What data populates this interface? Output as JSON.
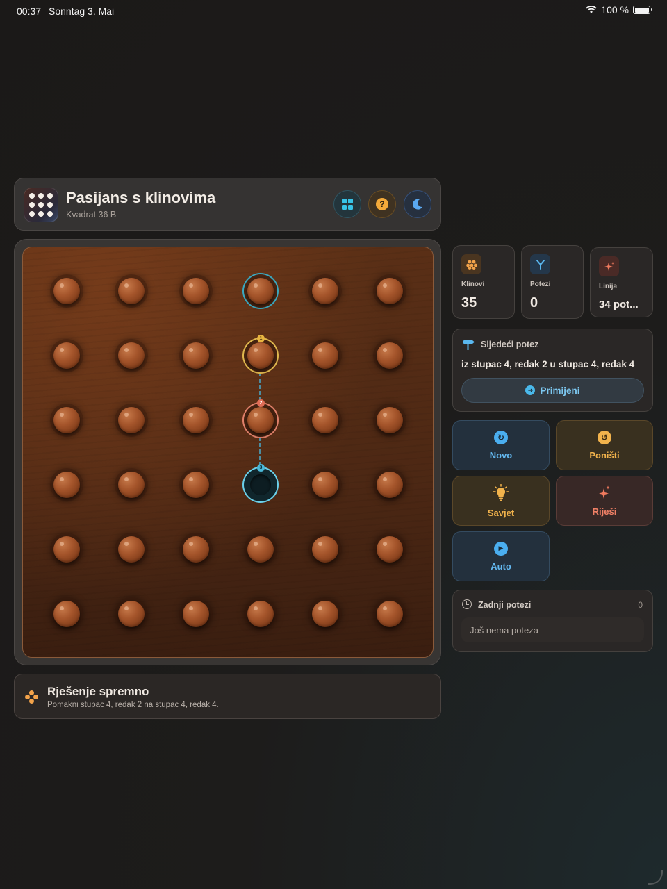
{
  "status": {
    "time": "00:37",
    "date": "Sonntag 3. Mai",
    "battery": "100 %"
  },
  "header": {
    "title": "Pasijans s klinovima",
    "subtitle": "Kvadrat 36 B",
    "buttons": [
      "grid-icon",
      "help-icon",
      "moon-icon"
    ]
  },
  "board": {
    "rows": 6,
    "cols": 6,
    "cells": [
      [
        1,
        1,
        1,
        1,
        1,
        1
      ],
      [
        1,
        1,
        1,
        1,
        1,
        1
      ],
      [
        1,
        1,
        1,
        1,
        1,
        1
      ],
      [
        1,
        1,
        1,
        0,
        1,
        1
      ],
      [
        1,
        1,
        1,
        1,
        1,
        1
      ],
      [
        1,
        1,
        1,
        1,
        1,
        1
      ]
    ],
    "highlights": {
      "selected": "r1c4",
      "move_from": "r2c4",
      "move_over": "r3c4",
      "move_to": "r4c4"
    },
    "move_badges": [
      "1",
      "2",
      "3"
    ]
  },
  "solution": {
    "title": "Rješenje spremno",
    "description": "Pomakni stupac 4, redak 2 na stupac 4, redak 4."
  },
  "stats": [
    {
      "label": "Klinovi",
      "value": "35",
      "icon": "pegs-icon",
      "color": "#f3a34a"
    },
    {
      "label": "Potezi",
      "value": "0",
      "icon": "branch-icon",
      "color": "#5ab8f0"
    },
    {
      "label": "Linija",
      "value": "34 pot...",
      "icon": "sparkle-icon",
      "color": "#f07a5e"
    }
  ],
  "hint": {
    "title": "Sljedeći potez",
    "text": "iz stupac 4, redak 2 u stupac 4, redak 4",
    "apply_label": "Primijeni"
  },
  "actions": {
    "new": "Novo",
    "undo": "Poništi",
    "tip": "Savjet",
    "solve": "Riješi",
    "auto": "Auto"
  },
  "recent": {
    "title": "Zadnji potezi",
    "count": "0",
    "empty": "Još nema poteza"
  }
}
